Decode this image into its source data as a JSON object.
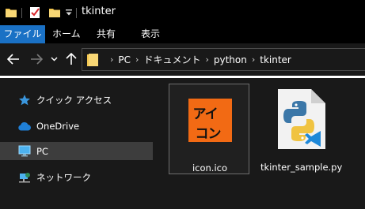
{
  "window": {
    "title": "tkinter"
  },
  "quick_access_toolbar": {
    "icons": [
      "folder-icon",
      "properties-icon",
      "new-folder-icon",
      "customize-arrow-icon"
    ]
  },
  "ribbon": {
    "tabs": [
      {
        "label": "ファイル",
        "active": true
      },
      {
        "label": "ホーム"
      },
      {
        "label": "共有"
      },
      {
        "label": "表示"
      }
    ]
  },
  "navigation": {
    "back_icon": "arrow-left-icon",
    "forward_icon": "arrow-right-icon",
    "recent_icon": "chevron-down-icon",
    "up_icon": "arrow-up-icon"
  },
  "address_bar": {
    "breadcrumbs": [
      "PC",
      "ドキュメント",
      "python",
      "tkinter"
    ]
  },
  "nav_pane": {
    "items": [
      {
        "label": "クイック アクセス",
        "icon": "star-icon"
      },
      {
        "label": "OneDrive",
        "icon": "cloud-icon"
      },
      {
        "label": "PC",
        "icon": "monitor-icon",
        "selected": true
      },
      {
        "label": "ネットワーク",
        "icon": "network-icon"
      }
    ]
  },
  "files": [
    {
      "name": "icon.ico",
      "thumbnail_text": [
        "アイ",
        "コン"
      ],
      "thumbnail_color": "#f26a14",
      "selected": true
    },
    {
      "name": "tkinter_sample.py",
      "icon": "python-file-icon"
    }
  ],
  "colors": {
    "accent": "#1a71c5",
    "background": "#191919",
    "titlebar": "#000000"
  }
}
